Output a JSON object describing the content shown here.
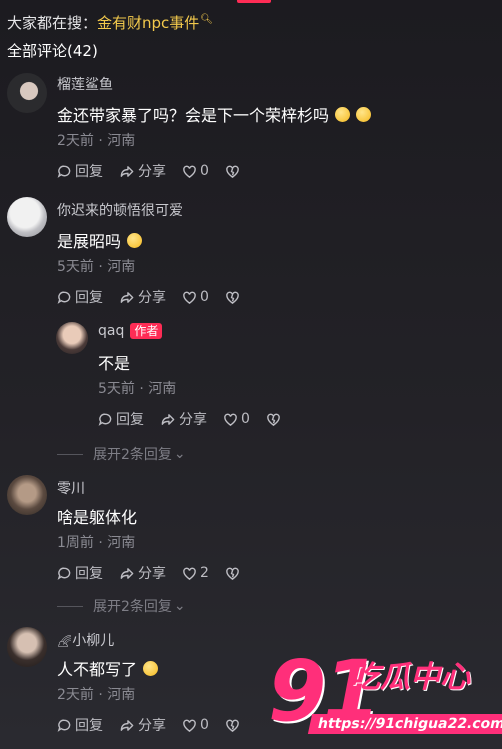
{
  "search": {
    "prefix": "大家都在搜：",
    "keyword": "金有财npc事件"
  },
  "comments_count": "全部评论(42)",
  "actions": {
    "reply": "回复",
    "share": "分享"
  },
  "comments": [
    {
      "author": "榴莲鲨鱼",
      "text": "金还带家暴了吗？会是下一个荣梓杉吗",
      "time": "2天前",
      "location": "河南",
      "likes": "0"
    },
    {
      "author": "你迟来的顿悟很可爱",
      "text": "是展昭吗",
      "time": "5天前",
      "location": "河南",
      "likes": "0",
      "reply": {
        "author": "qaq",
        "badge": "作者",
        "text": "不是",
        "time": "5天前",
        "location": "河南",
        "likes": "0"
      },
      "expand": "展开2条回复"
    },
    {
      "author": "零川",
      "text": "啥是躯体化",
      "time": "1周前",
      "location": "河南",
      "likes": "2",
      "expand": "展开2条回复"
    },
    {
      "author": "小柳儿",
      "text": "人不都写了",
      "time": "2天前",
      "location": "河南",
      "likes": "0"
    }
  ],
  "watermark": {
    "number": "91",
    "name": "吃瓜中心",
    "url": "https://91chigua22.com"
  },
  "colors": {
    "accent": "#fe2c55",
    "keyword": "#f2c94c",
    "watermark": "#ff2f7a"
  }
}
